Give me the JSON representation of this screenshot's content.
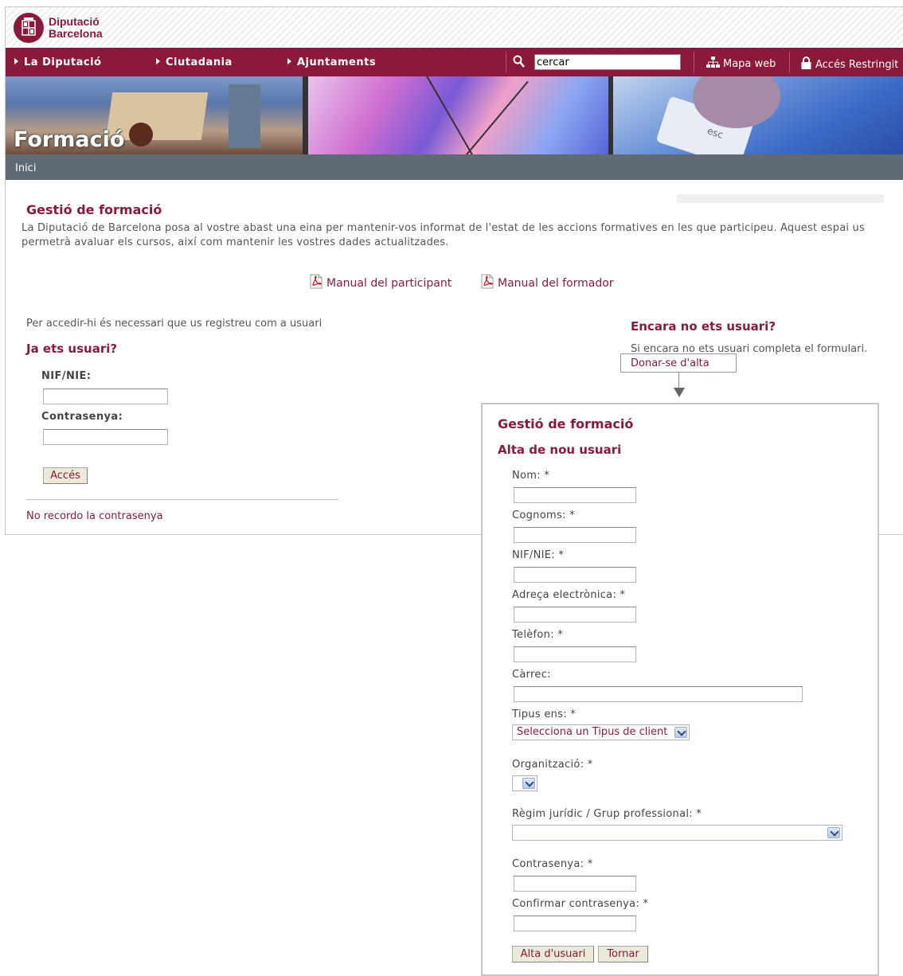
{
  "brand": {
    "line1": "Diputació",
    "line2": "Barcelona"
  },
  "nav": {
    "items": [
      "La Diputació",
      "Ciutadania",
      "Ajuntaments"
    ],
    "search_value": "cercar",
    "links": {
      "sitemap": "Mapa web",
      "restricted": "Accés Restringit"
    }
  },
  "banner": {
    "title": "Formació",
    "key_label": "esc"
  },
  "breadcrumb": "Inici",
  "main": {
    "title": "Gestió de formació",
    "intro": "La Diputació de Barcelona posa al vostre abast una eina per mantenir-vos informat de l'estat de les accions formatives en les que participeu. Aquest espai us permetrà avaluar els cursos, així com mantenir les vostres dades actualitzades.",
    "manuals": [
      "Manual del participant",
      "Manual del formador"
    ],
    "access_note": "Per accedir-hi és necessari que us registreu com a usuari"
  },
  "login": {
    "heading": "Ja ets usuari?",
    "nif_label": "NIF/NIE:",
    "password_label": "Contrasenya:",
    "submit_label": "Accés",
    "forgot_link": "No recordo la contrasenya"
  },
  "signup": {
    "heading": "Encara no ets usuari?",
    "text": "Si encara no ets usuari completa el formulari.",
    "callout": "Donar-se d'alta"
  },
  "popup": {
    "title": "Gestió de formació",
    "subtitle": "Alta de nou usuari",
    "fields": {
      "nom": "Nom: *",
      "cognoms": "Cognoms: *",
      "nif": "NIF/NIE: *",
      "email": "Adreça electrònica: *",
      "telefon": "Telèfon: *",
      "carrec": "Càrrec:",
      "tipus": "Tipus ens: *",
      "organitzacio": "Organització: *",
      "regim": "Règim jurídic / Grup professional: *",
      "password": "Contrasenya: *",
      "confirm": "Confirmar contrasenya: *"
    },
    "tipus_selected": "Selecciona un Tipus de client",
    "buttons": {
      "submit": "Alta d'usuari",
      "back": "Tornar"
    }
  },
  "colors": {
    "brand": "#8b1a3a",
    "crumbbar": "#606a74"
  }
}
